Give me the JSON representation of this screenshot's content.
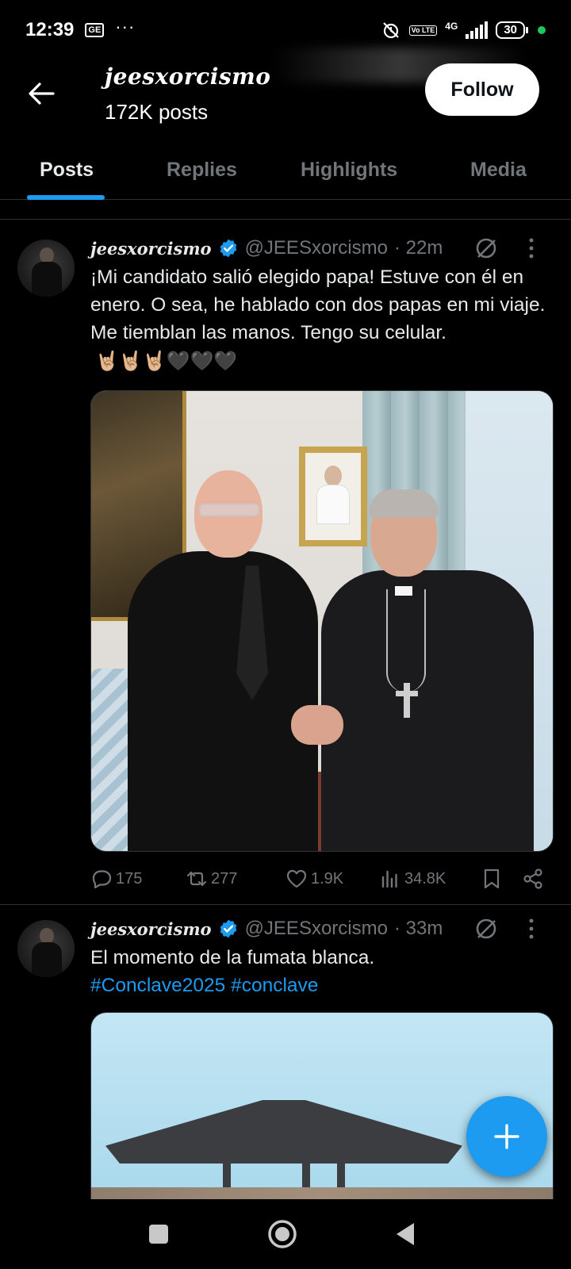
{
  "status_bar": {
    "time": "12:39",
    "sim_chip": "GE",
    "dots": "···",
    "network": "4G",
    "volte": "Vo LTE",
    "battery": "30"
  },
  "header": {
    "display_name": "jeesxorcismo",
    "posts_count": "172K posts",
    "follow_label": "Follow"
  },
  "tabs": [
    {
      "label": "Posts",
      "active": true
    },
    {
      "label": "Replies",
      "active": false
    },
    {
      "label": "Highlights",
      "active": false
    },
    {
      "label": "Media",
      "active": false
    }
  ],
  "posts": [
    {
      "name": "jeesxorcismo",
      "handle": "@JEESxorcismo",
      "time": "· 22m",
      "text": "¡Mi candidato salió elegido papa! Estuve con él en enero. O sea, he hablado con dos papas en mi viaje. Me tiemblan las manos. Tengo su celular.",
      "emojis": "🤘🏼🤘🏼🤘🏼🖤🖤🖤",
      "replies": "175",
      "reposts": "277",
      "likes": "1.9K",
      "views": "34.8K"
    },
    {
      "name": "jeesxorcismo",
      "handle": "@JEESxorcismo",
      "time": "· 33m",
      "text": "El momento de la fumata blanca.",
      "hashtags": "#Conclave2025 #conclave"
    }
  ],
  "colors": {
    "accent": "#1d9bf0",
    "muted": "#71767b",
    "text": "#e7e9ea",
    "background": "#000000",
    "border": "#2f3336"
  },
  "icons": [
    "back-arrow-icon",
    "verified-icon",
    "grok-icon",
    "more-icon",
    "reply-icon",
    "repost-icon",
    "like-icon",
    "views-icon",
    "bookmark-icon",
    "share-icon",
    "compose-plus-icon",
    "nav-recents-icon",
    "nav-home-icon",
    "nav-back-icon"
  ]
}
